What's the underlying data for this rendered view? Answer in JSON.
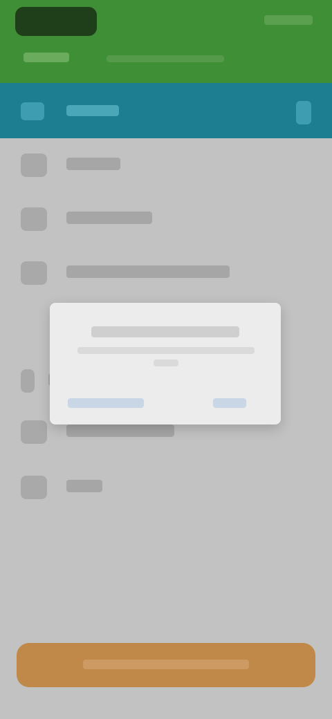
{
  "app": {
    "title": ""
  },
  "toolbar": {
    "title": ""
  },
  "menu": {
    "items": [
      {
        "label": ""
      },
      {
        "label": ""
      },
      {
        "label": ""
      },
      {
        "label": ""
      },
      {
        "label": ""
      },
      {
        "label": ""
      }
    ]
  },
  "dialog": {
    "title": "",
    "message": "",
    "negative_label": "",
    "positive_label": ""
  },
  "bottom_action": {
    "label": ""
  },
  "colors": {
    "status_bar": "#3e8f35",
    "toolbar": "#1d7e92",
    "content_bg": "#c2c2c2",
    "dialog_bg": "#ececec",
    "button_bg": "#c0894a"
  }
}
